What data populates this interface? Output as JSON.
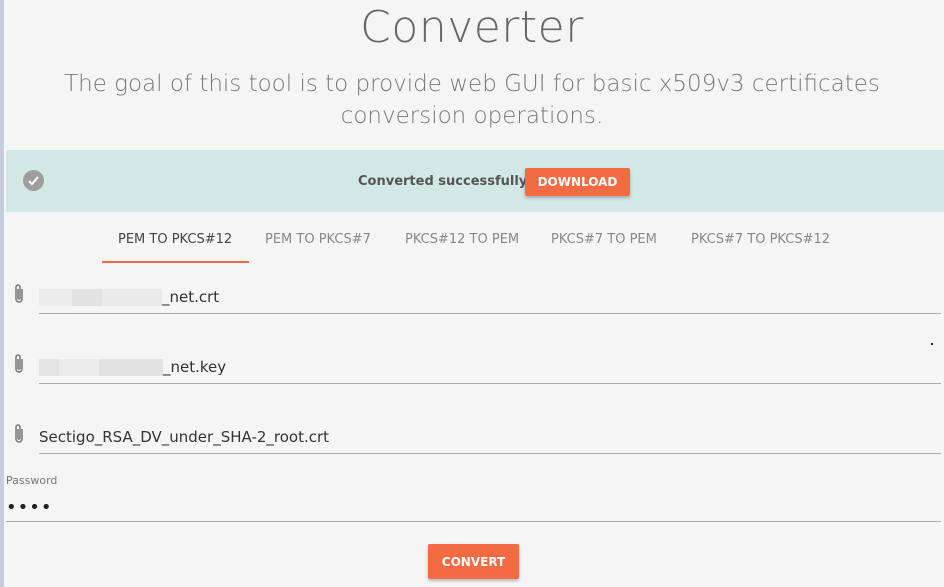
{
  "header": {
    "title": "Converter",
    "subtitle": "The goal of this tool is to provide web GUI for basic x509v3 certificates conversion operations."
  },
  "banner": {
    "icon": "check-circle-icon",
    "message": "Converted successfully!",
    "download_label": "DOWNLOAD"
  },
  "tabs": [
    {
      "label": "PEM TO PKCS#12",
      "active": true
    },
    {
      "label": "PEM TO PKCS#7",
      "active": false
    },
    {
      "label": "PKCS#12 TO PEM",
      "active": false
    },
    {
      "label": "PKCS#7 TO PEM",
      "active": false
    },
    {
      "label": "PKCS#7 TO PKCS#12",
      "active": false
    }
  ],
  "files": [
    {
      "icon": "paperclip-icon",
      "name_suffix": "_net.crt"
    },
    {
      "icon": "paperclip-icon",
      "name_suffix": "_net.key"
    },
    {
      "icon": "paperclip-icon",
      "name": "Sectigo_RSA_DV_under_SHA-2_root.crt"
    }
  ],
  "password": {
    "label": "Password",
    "value": "••••"
  },
  "convert_label": "CONVERT",
  "colors": {
    "accent": "#f26b43",
    "banner_bg": "#d2e8e5",
    "page_bg": "#f5f5f5"
  }
}
